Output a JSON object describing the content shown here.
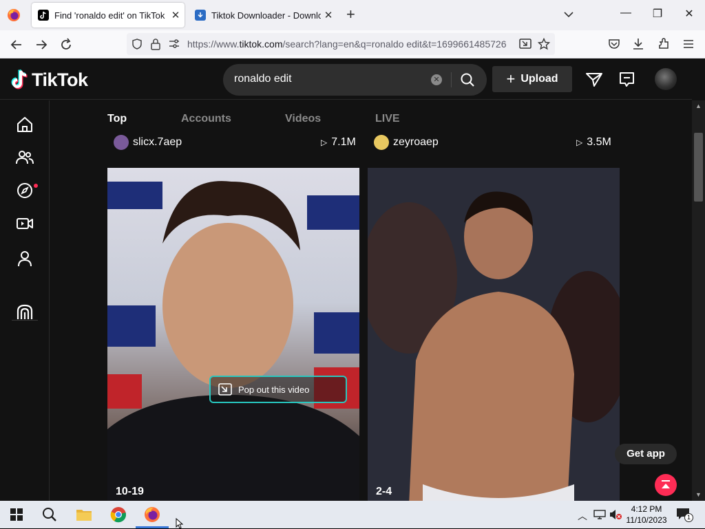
{
  "browser": {
    "tabs": [
      {
        "title": "Find 'ronaldo edit' on TikTok | Ti",
        "active": true
      },
      {
        "title": "Tiktok Downloader - Download",
        "active": false
      }
    ],
    "url_prefix": "https://www.",
    "url_domain": "tiktok.com",
    "url_rest": "/search?lang=en&q=ronaldo edit&t=1699661485726"
  },
  "tiktok": {
    "logo": "TikTok",
    "search": {
      "value": "ronaldo edit"
    },
    "upload_label": "Upload",
    "tabs": [
      "Top",
      "Accounts",
      "Videos",
      "LIVE"
    ],
    "results": [
      {
        "username": "slicx.7aep",
        "views": "7.1M",
        "count": "10-19"
      },
      {
        "username": "zeyroaep",
        "views": "3.5M",
        "count": "2-4"
      }
    ],
    "popout_label": "Pop out this video",
    "get_app": "Get app",
    "brand_color": "#fe2c55"
  },
  "taskbar": {
    "time": "4:12 PM",
    "date": "11/10/2023",
    "notification_count": "1"
  }
}
